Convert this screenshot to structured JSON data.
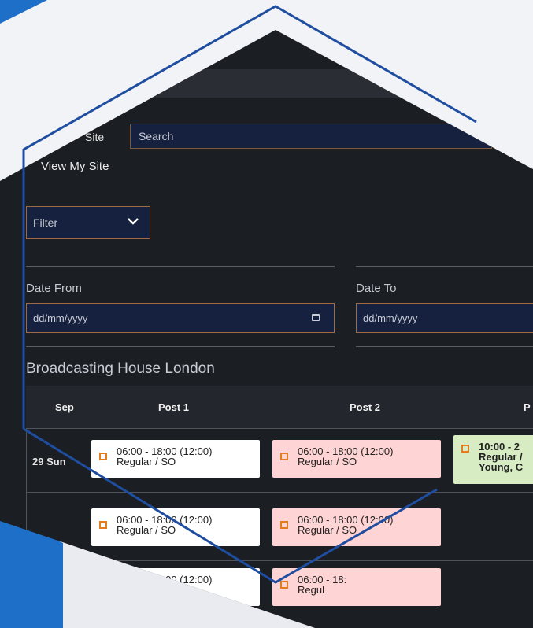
{
  "site_search": {
    "label": "Site",
    "placeholder": "Search"
  },
  "view_my_site": "View My Site",
  "filter": {
    "selected": "Filter"
  },
  "date_from": {
    "label": "Date From",
    "placeholder": "dd/mm/yyyy"
  },
  "date_to": {
    "label": "Date To",
    "placeholder": "dd/mm/yyyy"
  },
  "site_title": "Broadcasting House London",
  "table": {
    "columns": [
      "Sep",
      "Post 1",
      "Post 2",
      "P"
    ],
    "rows": [
      {
        "date": "29 Sun",
        "cells": [
          {
            "time": "06:00 - 18:00 (12:00)",
            "type": "Regular / SO"
          },
          {
            "time": "06:00 - 18:00 (12:00)",
            "type": "Regular / SO"
          },
          {
            "time": "10:00 - 2",
            "type": "Regular /",
            "extra": "Young, C"
          }
        ]
      },
      {
        "date": "",
        "cells": [
          {
            "time": "06:00 - 18:00 (12:00)",
            "type": "Regular / SO"
          },
          {
            "time": "06:00 - 18:00 (12:00)",
            "type": "Regular / SO"
          }
        ]
      },
      {
        "date": "",
        "cells": [
          {
            "time": "06:00 - 18:00 (12:00)",
            "type": ""
          },
          {
            "time": "06:00 - 18:",
            "type": "Regul"
          }
        ]
      }
    ]
  },
  "colors": {
    "background": "#1b1e22",
    "input_bg": "#16213f",
    "accent_border": "#a06a44",
    "cell_white": "#ffffff",
    "cell_pink": "#ffd4d4",
    "cell_green": "#d8ecc4",
    "checkbox": "#e47b1c",
    "hex_outline": "#1f4ea0",
    "brand_blue": "#1e6fc8"
  },
  "icons": {
    "filter_chevron": "chevron-down-icon",
    "date_picker": "calendar-icon",
    "checkbox": "checkbox-icon"
  }
}
